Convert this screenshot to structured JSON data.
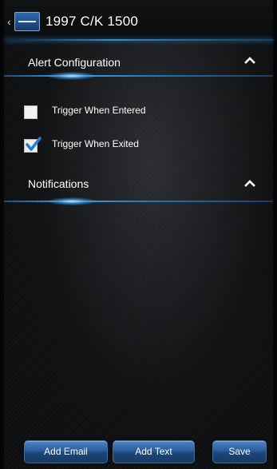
{
  "header": {
    "title": "1997 C/K 1500",
    "back_icon": "chevron-left-icon",
    "logo_icon": "vehicle-badge-icon"
  },
  "alert_configuration": {
    "title": "Alert Configuration",
    "toggle_icon": "chevron-up-icon",
    "options": [
      {
        "label": "Trigger When Entered",
        "checked": false
      },
      {
        "label": "Trigger When Exited",
        "checked": true
      }
    ]
  },
  "notifications": {
    "title": "Notifications",
    "toggle_icon": "chevron-up-icon"
  },
  "footer": {
    "add_email_label": "Add Email",
    "add_text_label": "Add Text",
    "save_label": "Save"
  },
  "colors": {
    "accent": "#2d8fd8",
    "button": "#2a5d9c",
    "background": "#0e0f11"
  }
}
